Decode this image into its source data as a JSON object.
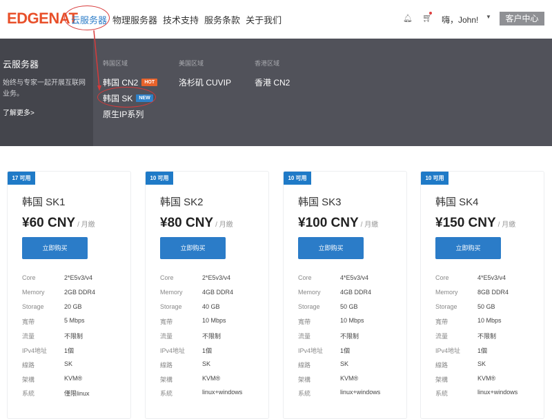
{
  "brand": {
    "logo": "EDGENAT"
  },
  "nav": {
    "items": [
      "云服务器",
      "物理服务器",
      "技术支持",
      "服务条款",
      "关于我们"
    ]
  },
  "header": {
    "greeting": "嗨，John!",
    "client_center": "客户中心"
  },
  "dropdown": {
    "title": "云服务器",
    "description": "始终与专家一起开展互联网业务。",
    "more": "了解更多>",
    "columns": [
      {
        "head": "韩国区域",
        "items": [
          {
            "label": "韩国 CN2",
            "tag": "HOT"
          },
          {
            "label": "韩国 SK",
            "tag": "NEW"
          },
          {
            "label": "原生IP系列",
            "tag": ""
          }
        ]
      },
      {
        "head": "美国区域",
        "items": [
          {
            "label": "洛杉矶 CUVIP",
            "tag": ""
          }
        ]
      },
      {
        "head": "香港区域",
        "items": [
          {
            "label": "香港 CN2",
            "tag": ""
          }
        ]
      }
    ]
  },
  "plans": [
    {
      "badge": "17 可用",
      "name": "韩国 SK1",
      "price": "¥60 CNY",
      "per": "/ 月繳",
      "buy": "立即购买",
      "specs": [
        [
          "Core",
          "2*E5v3/v4"
        ],
        [
          "Memory",
          "2GB DDR4"
        ],
        [
          "Storage",
          "20 GB"
        ],
        [
          "寬帶",
          "5 Mbps"
        ],
        [
          "流量",
          "不限制"
        ],
        [
          "IPv4地址",
          "1個"
        ],
        [
          "線路",
          "SK"
        ],
        [
          "架構",
          "KVM®"
        ],
        [
          "系統",
          "僅限linux"
        ]
      ]
    },
    {
      "badge": "10 可用",
      "name": "韩国 SK2",
      "price": "¥80 CNY",
      "per": "/ 月繳",
      "buy": "立即购买",
      "specs": [
        [
          "Core",
          "2*E5v3/v4"
        ],
        [
          "Memory",
          "4GB DDR4"
        ],
        [
          "Storage",
          "40 GB"
        ],
        [
          "寬帶",
          "10 Mbps"
        ],
        [
          "流量",
          "不限制"
        ],
        [
          "IPv4地址",
          "1個"
        ],
        [
          "線路",
          "SK"
        ],
        [
          "架構",
          "KVM®"
        ],
        [
          "系統",
          "linux+windows"
        ]
      ]
    },
    {
      "badge": "10 可用",
      "name": "韩国 SK3",
      "price": "¥100 CNY",
      "per": "/ 月繳",
      "buy": "立即购买",
      "specs": [
        [
          "Core",
          "4*E5v3/v4"
        ],
        [
          "Memory",
          "4GB DDR4"
        ],
        [
          "Storage",
          "50 GB"
        ],
        [
          "寬帶",
          "10 Mbps"
        ],
        [
          "流量",
          "不限制"
        ],
        [
          "IPv4地址",
          "1個"
        ],
        [
          "線路",
          "SK"
        ],
        [
          "架構",
          "KVM®"
        ],
        [
          "系統",
          "linux+windows"
        ]
      ]
    },
    {
      "badge": "10 可用",
      "name": "韩国 SK4",
      "price": "¥150 CNY",
      "per": "/ 月繳",
      "buy": "立即购买",
      "specs": [
        [
          "Core",
          "4*E5v3/v4"
        ],
        [
          "Memory",
          "8GB DDR4"
        ],
        [
          "Storage",
          "50 GB"
        ],
        [
          "寬帶",
          "10 Mbps"
        ],
        [
          "流量",
          "不限制"
        ],
        [
          "IPv4地址",
          "1個"
        ],
        [
          "線路",
          "SK"
        ],
        [
          "架構",
          "KVM®"
        ],
        [
          "系統",
          "linux+windows"
        ]
      ]
    }
  ]
}
